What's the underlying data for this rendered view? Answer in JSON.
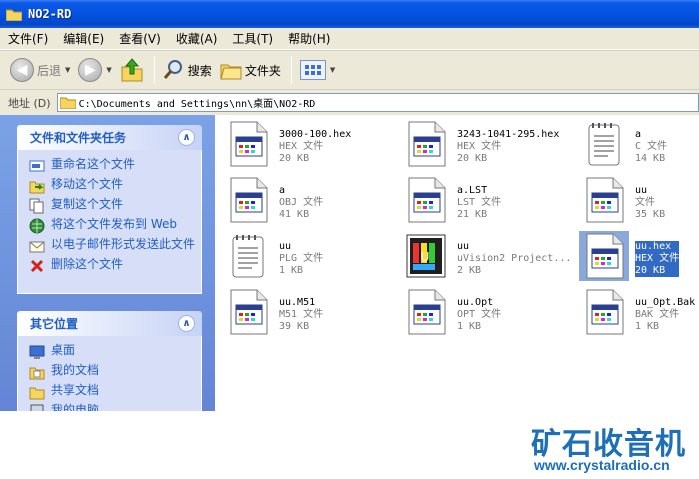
{
  "window": {
    "title": "NO2-RD"
  },
  "menu": [
    "文件(F)",
    "编辑(E)",
    "查看(V)",
    "收藏(A)",
    "工具(T)",
    "帮助(H)"
  ],
  "toolbar": {
    "back": "后退",
    "search": "搜索",
    "folders": "文件夹"
  },
  "address": {
    "label": "地址 (D)",
    "path": "C:\\Documents and Settings\\nn\\桌面\\NO2-RD"
  },
  "tasks_panel": {
    "title": "文件和文件夹任务",
    "items": [
      "重命名这个文件",
      "移动这个文件",
      "复制这个文件",
      "将这个文件发布到 Web",
      "以电子邮件形式发送此文件",
      "删除这个文件"
    ]
  },
  "places_panel": {
    "title": "其它位置",
    "items": [
      "桌面",
      "我的文档",
      "共享文档",
      "我的电脑"
    ]
  },
  "files": [
    {
      "name": "3000-100.hex",
      "type": "HEX 文件",
      "size": "20 KB",
      "icon": "app-doc-icon"
    },
    {
      "name": "3243-1041-295.hex",
      "type": "HEX 文件",
      "size": "20 KB",
      "icon": "app-doc-icon"
    },
    {
      "name": "a",
      "type": "C 文件",
      "size": "14 KB",
      "icon": "notepad-icon"
    },
    {
      "name": "a",
      "type": "OBJ 文件",
      "size": "41 KB",
      "icon": "app-doc-icon"
    },
    {
      "name": "a.LST",
      "type": "LST 文件",
      "size": "21 KB",
      "icon": "app-doc-icon"
    },
    {
      "name": "uu",
      "type": "文件",
      "size": "35 KB",
      "icon": "app-doc-icon"
    },
    {
      "name": "uu",
      "type": "PLG 文件",
      "size": "1 KB",
      "icon": "notepad-icon"
    },
    {
      "name": "uu",
      "type": "uVision2 Project...",
      "size": "2 KB",
      "icon": "uvision-icon"
    },
    {
      "name": "uu.hex",
      "type": "HEX 文件",
      "size": "20 KB",
      "icon": "app-doc-icon",
      "selected": true
    },
    {
      "name": "uu.M51",
      "type": "M51 文件",
      "size": "39 KB",
      "icon": "app-doc-icon"
    },
    {
      "name": "uu.Opt",
      "type": "OPT 文件",
      "size": "1 KB",
      "icon": "app-doc-icon"
    },
    {
      "name": "uu_Opt.Bak",
      "type": "BAK 文件",
      "size": "1 KB",
      "icon": "app-doc-icon"
    }
  ],
  "watermark": {
    "brand": "矿石收音机",
    "url": "www.crystalradio.cn"
  },
  "colors": {
    "title_bar": "#0553e0",
    "task_link": "#215dc6",
    "selection": "#316ac5",
    "watermark": "#1d6fb8"
  }
}
